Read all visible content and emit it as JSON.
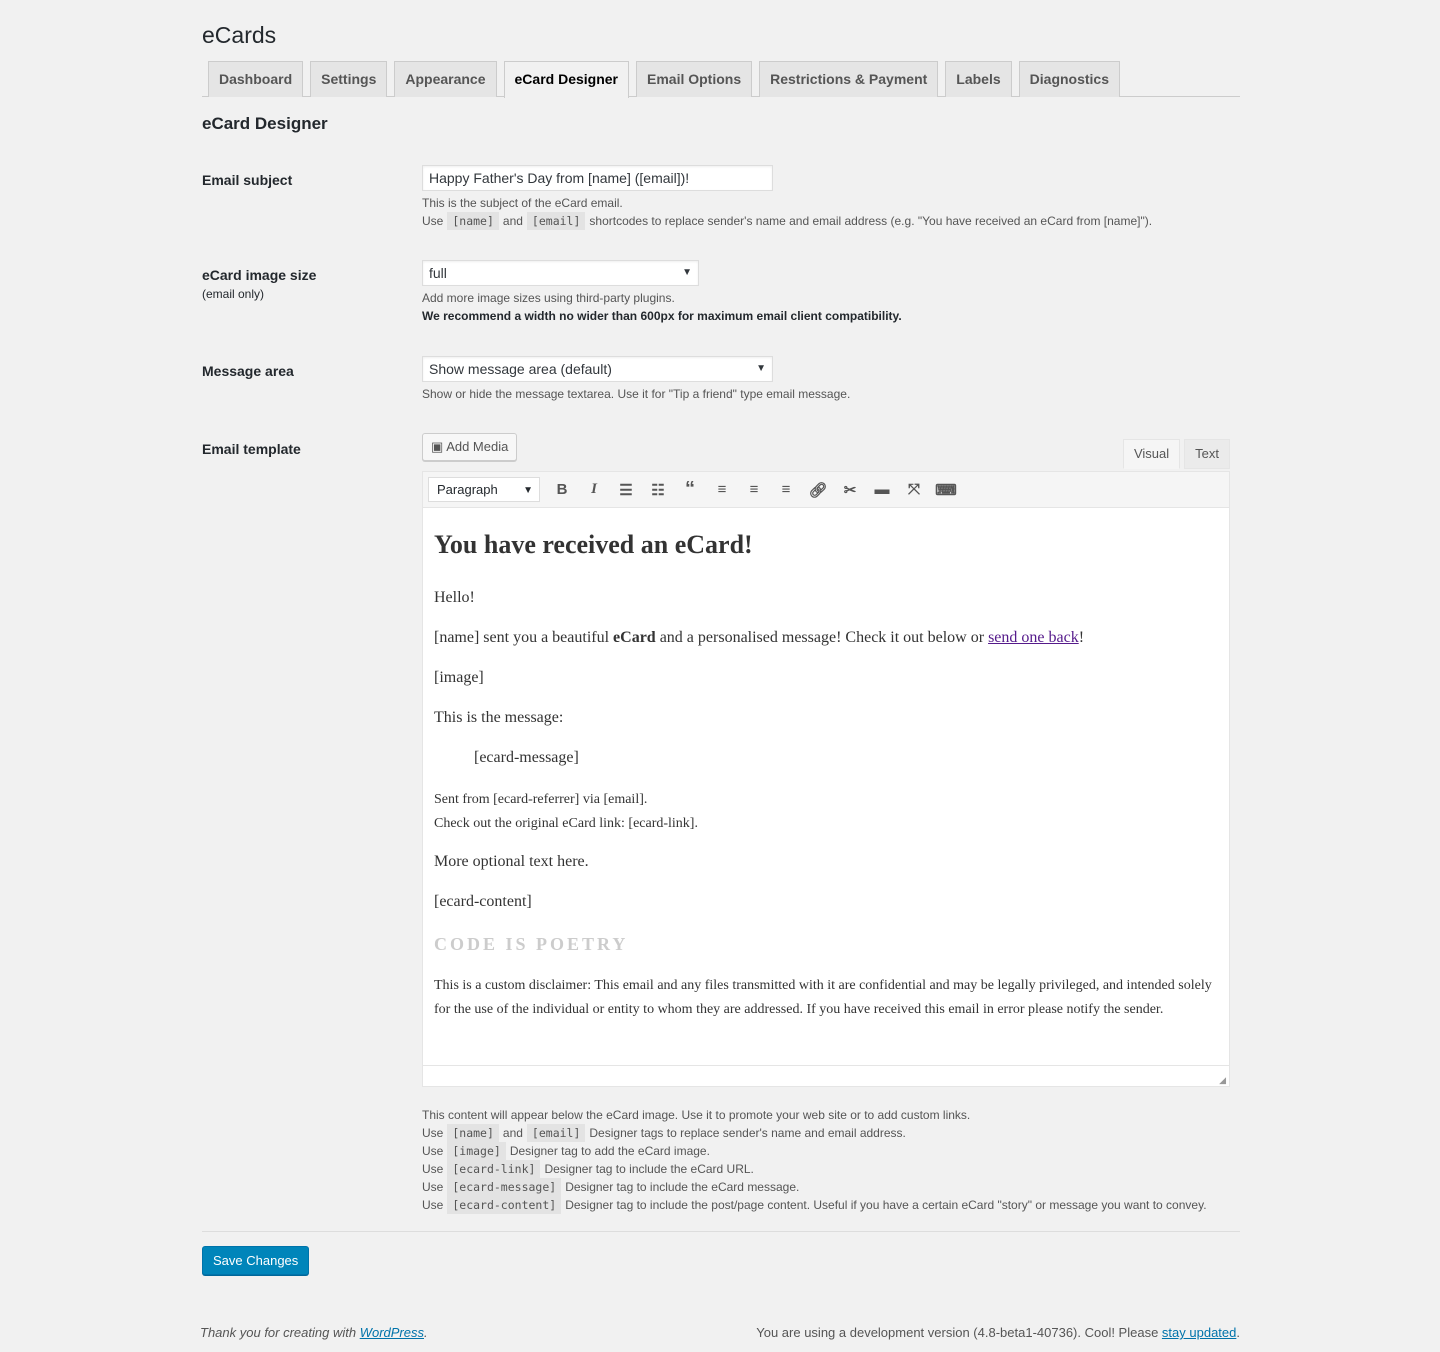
{
  "title": "eCards",
  "tabs": [
    "Dashboard",
    "Settings",
    "Appearance",
    "eCard Designer",
    "Email Options",
    "Restrictions & Payment",
    "Labels",
    "Diagnostics"
  ],
  "section_title": "eCard Designer",
  "email_subject": {
    "label": "Email subject",
    "value": "Happy Father's Day from [name] ([email])!",
    "desc1": "This is the subject of the eCard email.",
    "use": "Use",
    "code1": "[name]",
    "and": "and",
    "code2": "[email]",
    "desc2": "shortcodes to replace sender's name and email address (e.g. \"You have received an eCard from [name]\")."
  },
  "image_size": {
    "label": "eCard image size",
    "sub": "(email only)",
    "value": "full",
    "desc1": "Add more image sizes using third-party plugins.",
    "desc2": "We recommend a width no wider than 600px for maximum email client compatibility."
  },
  "message_area": {
    "label": "Message area",
    "value": "Show message area (default)",
    "desc": "Show or hide the message textarea. Use it for \"Tip a friend\" type email message."
  },
  "template": {
    "label": "Email template",
    "add_media": "Add Media",
    "visual": "Visual",
    "text": "Text",
    "format": "Paragraph",
    "toolbar": [
      "bold-icon",
      "italic-icon",
      "bullet-list-icon",
      "numbered-list-icon",
      "blockquote-icon",
      "align-left-icon",
      "align-center-icon",
      "align-right-icon",
      "link-icon",
      "unlink-icon",
      "read-more-icon",
      "fullscreen-icon",
      "toolbar-toggle-icon"
    ],
    "content": {
      "heading": "You have received an eCard!",
      "hello": "Hello!",
      "p1a": "[name] sent you a beautiful ",
      "p1b": "eCard",
      "p1c": " and a personalised message! Check it out below or ",
      "p1link": "send one back",
      "p1d": "!",
      "image": "[image]",
      "msg_intro": "This is the message:",
      "msg": "[ecard-message]",
      "sent": "Sent from [ecard-referrer] via [email].",
      "check": "Check out the original eCard link: [ecard-link].",
      "optional": "More optional text here.",
      "content": "[ecard-content]",
      "poetry": "CODE IS POETRY",
      "disclaimer": "This is a custom disclaimer: This email and any files transmitted with it are confidential and may be legally privileged, and intended solely for the use of the individual or entity to whom they are addressed. If you have received this email in error please notify the sender."
    }
  },
  "help": {
    "intro": "This content will appear below the eCard image. Use it to promote your web site or to add custom links.",
    "use": "Use",
    "and": "and",
    "lines": [
      {
        "codes": [
          "[name]",
          "[email]"
        ],
        "text": "Designer tags to replace sender's name and email address."
      },
      {
        "codes": [
          "[image]"
        ],
        "text": "Designer tag to add the eCard image."
      },
      {
        "codes": [
          "[ecard-link]"
        ],
        "text": "Designer tag to include the eCard URL."
      },
      {
        "codes": [
          "[ecard-message]"
        ],
        "text": "Designer tag to include the eCard message."
      },
      {
        "codes": [
          "[ecard-content]"
        ],
        "text": "Designer tag to include the post/page content. Useful if you have a certain eCard \"story\" or message you want to convey."
      }
    ]
  },
  "save": "Save Changes",
  "footer": {
    "left": "Thank you for creating with ",
    "left_link": "WordPress",
    "right": "You are using a development version (4.8-beta1-40736). Cool! Please ",
    "right_link": "stay updated",
    "period": "."
  },
  "colors": {
    "primary": "#0085ba",
    "link": "#0073aa"
  }
}
